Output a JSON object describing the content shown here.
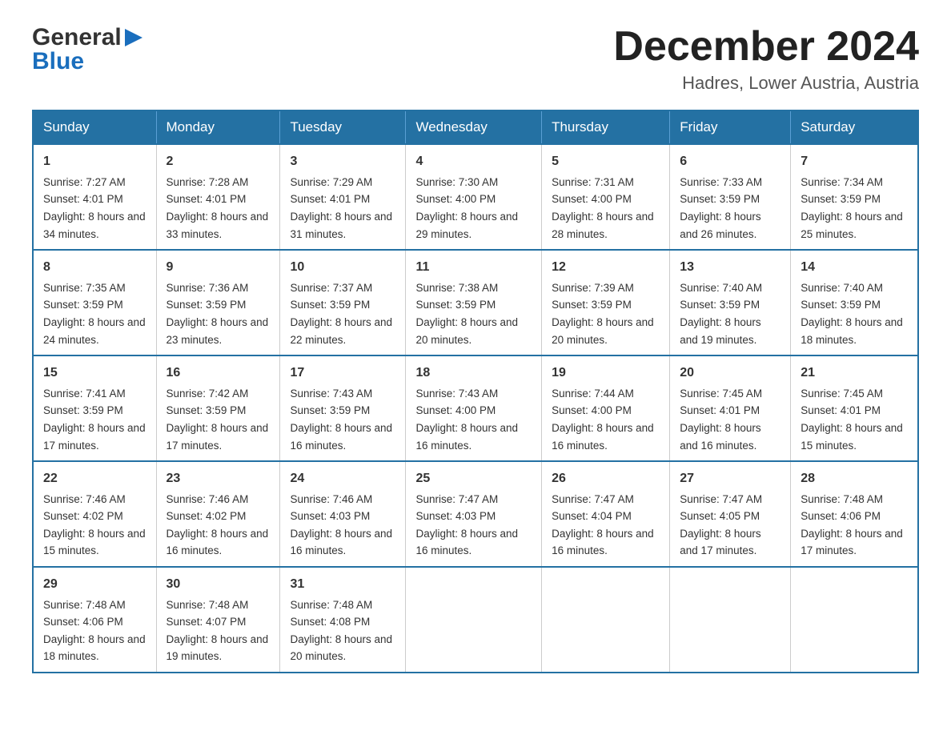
{
  "logo": {
    "line1": "General",
    "arrow": "▶",
    "line2": "Blue"
  },
  "title": "December 2024",
  "location": "Hadres, Lower Austria, Austria",
  "weekdays": [
    "Sunday",
    "Monday",
    "Tuesday",
    "Wednesday",
    "Thursday",
    "Friday",
    "Saturday"
  ],
  "weeks": [
    [
      {
        "day": "1",
        "sunrise": "7:27 AM",
        "sunset": "4:01 PM",
        "daylight": "8 hours and 34 minutes."
      },
      {
        "day": "2",
        "sunrise": "7:28 AM",
        "sunset": "4:01 PM",
        "daylight": "8 hours and 33 minutes."
      },
      {
        "day": "3",
        "sunrise": "7:29 AM",
        "sunset": "4:01 PM",
        "daylight": "8 hours and 31 minutes."
      },
      {
        "day": "4",
        "sunrise": "7:30 AM",
        "sunset": "4:00 PM",
        "daylight": "8 hours and 29 minutes."
      },
      {
        "day": "5",
        "sunrise": "7:31 AM",
        "sunset": "4:00 PM",
        "daylight": "8 hours and 28 minutes."
      },
      {
        "day": "6",
        "sunrise": "7:33 AM",
        "sunset": "3:59 PM",
        "daylight": "8 hours and 26 minutes."
      },
      {
        "day": "7",
        "sunrise": "7:34 AM",
        "sunset": "3:59 PM",
        "daylight": "8 hours and 25 minutes."
      }
    ],
    [
      {
        "day": "8",
        "sunrise": "7:35 AM",
        "sunset": "3:59 PM",
        "daylight": "8 hours and 24 minutes."
      },
      {
        "day": "9",
        "sunrise": "7:36 AM",
        "sunset": "3:59 PM",
        "daylight": "8 hours and 23 minutes."
      },
      {
        "day": "10",
        "sunrise": "7:37 AM",
        "sunset": "3:59 PM",
        "daylight": "8 hours and 22 minutes."
      },
      {
        "day": "11",
        "sunrise": "7:38 AM",
        "sunset": "3:59 PM",
        "daylight": "8 hours and 20 minutes."
      },
      {
        "day": "12",
        "sunrise": "7:39 AM",
        "sunset": "3:59 PM",
        "daylight": "8 hours and 20 minutes."
      },
      {
        "day": "13",
        "sunrise": "7:40 AM",
        "sunset": "3:59 PM",
        "daylight": "8 hours and 19 minutes."
      },
      {
        "day": "14",
        "sunrise": "7:40 AM",
        "sunset": "3:59 PM",
        "daylight": "8 hours and 18 minutes."
      }
    ],
    [
      {
        "day": "15",
        "sunrise": "7:41 AM",
        "sunset": "3:59 PM",
        "daylight": "8 hours and 17 minutes."
      },
      {
        "day": "16",
        "sunrise": "7:42 AM",
        "sunset": "3:59 PM",
        "daylight": "8 hours and 17 minutes."
      },
      {
        "day": "17",
        "sunrise": "7:43 AM",
        "sunset": "3:59 PM",
        "daylight": "8 hours and 16 minutes."
      },
      {
        "day": "18",
        "sunrise": "7:43 AM",
        "sunset": "4:00 PM",
        "daylight": "8 hours and 16 minutes."
      },
      {
        "day": "19",
        "sunrise": "7:44 AM",
        "sunset": "4:00 PM",
        "daylight": "8 hours and 16 minutes."
      },
      {
        "day": "20",
        "sunrise": "7:45 AM",
        "sunset": "4:01 PM",
        "daylight": "8 hours and 16 minutes."
      },
      {
        "day": "21",
        "sunrise": "7:45 AM",
        "sunset": "4:01 PM",
        "daylight": "8 hours and 15 minutes."
      }
    ],
    [
      {
        "day": "22",
        "sunrise": "7:46 AM",
        "sunset": "4:02 PM",
        "daylight": "8 hours and 15 minutes."
      },
      {
        "day": "23",
        "sunrise": "7:46 AM",
        "sunset": "4:02 PM",
        "daylight": "8 hours and 16 minutes."
      },
      {
        "day": "24",
        "sunrise": "7:46 AM",
        "sunset": "4:03 PM",
        "daylight": "8 hours and 16 minutes."
      },
      {
        "day": "25",
        "sunrise": "7:47 AM",
        "sunset": "4:03 PM",
        "daylight": "8 hours and 16 minutes."
      },
      {
        "day": "26",
        "sunrise": "7:47 AM",
        "sunset": "4:04 PM",
        "daylight": "8 hours and 16 minutes."
      },
      {
        "day": "27",
        "sunrise": "7:47 AM",
        "sunset": "4:05 PM",
        "daylight": "8 hours and 17 minutes."
      },
      {
        "day": "28",
        "sunrise": "7:48 AM",
        "sunset": "4:06 PM",
        "daylight": "8 hours and 17 minutes."
      }
    ],
    [
      {
        "day": "29",
        "sunrise": "7:48 AM",
        "sunset": "4:06 PM",
        "daylight": "8 hours and 18 minutes."
      },
      {
        "day": "30",
        "sunrise": "7:48 AM",
        "sunset": "4:07 PM",
        "daylight": "8 hours and 19 minutes."
      },
      {
        "day": "31",
        "sunrise": "7:48 AM",
        "sunset": "4:08 PM",
        "daylight": "8 hours and 20 minutes."
      },
      null,
      null,
      null,
      null
    ]
  ],
  "labels": {
    "sunrise": "Sunrise:",
    "sunset": "Sunset:",
    "daylight": "Daylight:"
  }
}
